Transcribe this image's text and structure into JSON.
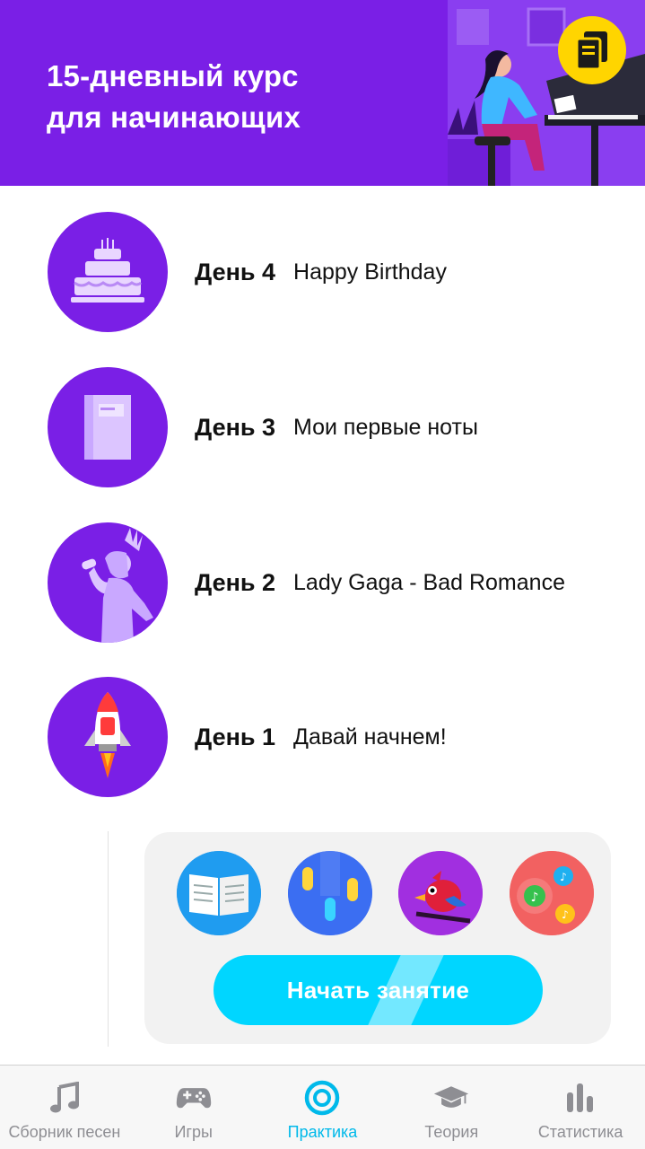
{
  "header": {
    "title_line1": "15-дневный курс",
    "title_line2": "для начинающих"
  },
  "days": [
    {
      "label": "День 4",
      "title": "Happy Birthday",
      "icon": "birthday-cake-icon"
    },
    {
      "label": "День 3",
      "title": "Мои первые ноты",
      "icon": "book-icon"
    },
    {
      "label": "День 2",
      "title": "Lady Gaga - Bad Romance",
      "icon": "singer-icon"
    },
    {
      "label": "День 1",
      "title": "Давай начнем!",
      "icon": "rocket-icon"
    }
  ],
  "activities": {
    "icons": [
      "open-book-icon",
      "falling-notes-icon",
      "bird-icon",
      "music-notes-bubbles-icon"
    ],
    "start_button_label": "Начать занятие"
  },
  "tabbar": {
    "tabs": [
      {
        "label": "Сборник песен",
        "icon": "music-note-icon",
        "active": false
      },
      {
        "label": "Игры",
        "icon": "gamepad-icon",
        "active": false
      },
      {
        "label": "Практика",
        "icon": "target-icon",
        "active": true
      },
      {
        "label": "Теория",
        "icon": "graduation-cap-icon",
        "active": false
      },
      {
        "label": "Статистика",
        "icon": "bar-chart-icon",
        "active": false
      }
    ]
  },
  "colors": {
    "brand_purple": "#7a1fe6",
    "accent_cyan": "#00d6ff",
    "active_tab": "#00b9ea",
    "badge_yellow": "#ffd500"
  }
}
